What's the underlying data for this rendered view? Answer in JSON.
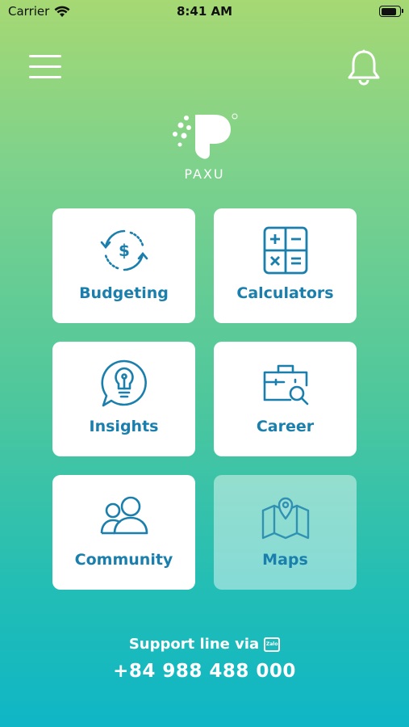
{
  "status_bar": {
    "carrier": "Carrier",
    "time": "8:41 AM",
    "battery_level": 0.9
  },
  "header": {
    "menu_icon": "hamburger-menu-icon",
    "notification_icon": "bell-icon"
  },
  "brand": {
    "name": "PAXU"
  },
  "tiles": [
    {
      "label": "Budgeting",
      "icon": "budget-cycle-icon"
    },
    {
      "label": "Calculators",
      "icon": "calculator-icon"
    },
    {
      "label": "Insights",
      "icon": "lightbulb-chat-icon"
    },
    {
      "label": "Career",
      "icon": "briefcase-search-icon"
    },
    {
      "label": "Community",
      "icon": "people-icon"
    },
    {
      "label": "Maps",
      "icon": "map-pin-icon"
    }
  ],
  "support": {
    "label": "Support line via",
    "chat_icon_text": "Zalo",
    "phone": "+84 988 488 000"
  },
  "colors": {
    "accent": "#1a7fac",
    "gradient_top": "#a6d873",
    "gradient_bottom": "#0fb6c6"
  }
}
